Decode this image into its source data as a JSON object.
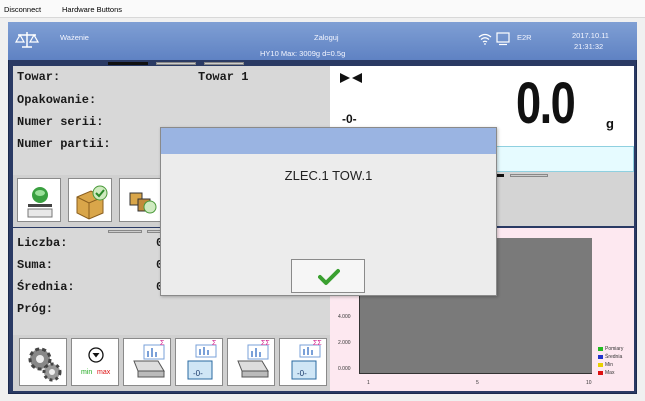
{
  "menubar": {
    "items": [
      "Disconnect",
      "Hardware Buttons"
    ]
  },
  "header": {
    "mode": "Ważenie",
    "login": "Zaloguj",
    "scale_info": "HY10  Max: 3009g  d=0.5g",
    "e2r": "E2R",
    "date": "2017.10.11",
    "time": "21:31:32"
  },
  "info": {
    "rows": [
      {
        "label": "Towar:",
        "value": "Towar 1"
      },
      {
        "label": "Opakowanie:",
        "value": ""
      },
      {
        "label": "Numer serii:",
        "value": ""
      },
      {
        "label": "Numer partii:",
        "value": ""
      }
    ]
  },
  "display": {
    "zero_mark": "-0-",
    "value": "0.0",
    "unit": "g"
  },
  "stats": {
    "rows": [
      {
        "label": "Liczba:",
        "value": "0"
      },
      {
        "label": "Suma:",
        "value": "0"
      },
      {
        "label": "Średnia:",
        "value": "0"
      },
      {
        "label": "Próg:",
        "value": ""
      }
    ]
  },
  "tools": {
    "minmax_min": "min",
    "minmax_max": "max",
    "zero_label": "-0-",
    "sigma": "Σ",
    "sigma2": "ΣΣ"
  },
  "dialog": {
    "message": "ZLEC.1 TOW.1"
  },
  "chart_data": {
    "type": "bar",
    "title": "",
    "yticks": [
      "0.000",
      "2.000",
      "4.000"
    ],
    "xticks": [
      "1",
      "5",
      "10"
    ],
    "categories": [],
    "series": [],
    "legend": [
      {
        "name": "Pomiary",
        "color": "#22bb22"
      },
      {
        "name": "Średnia",
        "color": "#2233cc"
      },
      {
        "name": "Min",
        "color": "#e8d000"
      },
      {
        "name": "Max",
        "color": "#dd1111"
      }
    ]
  }
}
